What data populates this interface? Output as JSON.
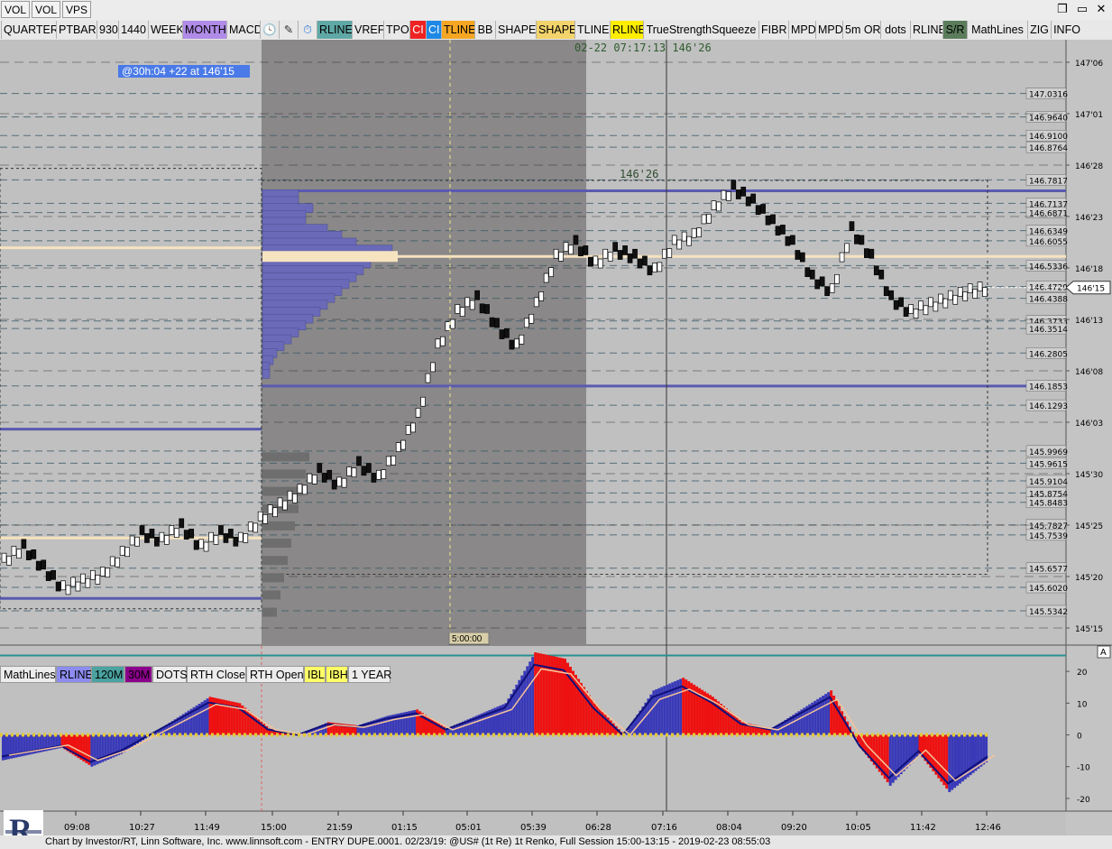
{
  "window": {
    "tabs": [
      "VOL",
      "VOL",
      "VPS"
    ],
    "controls": [
      "restore",
      "minimize",
      "close"
    ]
  },
  "toolbar": {
    "buttons": [
      {
        "label": "QUARTER",
        "bg": "#e8e8e8"
      },
      {
        "label": "PTBAR",
        "bg": "#e8e8e8"
      },
      {
        "label": "930",
        "bg": "#e8e8e8"
      },
      {
        "label": "1440",
        "bg": "#e8e8e8"
      },
      {
        "label": "WEEK",
        "bg": "#e8e8e8"
      },
      {
        "label": "MONTH",
        "bg": "#b08be8"
      },
      {
        "label": "MACD",
        "bg": "#e8e8e8"
      },
      {
        "label": "",
        "icon": "clock-icon",
        "bg": "#e8e8e8"
      },
      {
        "label": "",
        "icon": "pencil-icon",
        "bg": "#e8e8e8"
      },
      {
        "label": "",
        "icon": "stopwatch-icon",
        "bg": "#e8e8e8"
      },
      {
        "label": "RLINE",
        "bg": "#5fa8a6"
      },
      {
        "label": "VREF",
        "bg": "#e8e8e8"
      },
      {
        "label": "TPO",
        "bg": "#e8e8e8"
      },
      {
        "label": "CI",
        "bg": "#ee2222",
        "color": "#ffffff"
      },
      {
        "label": "CI",
        "bg": "#1e88e5",
        "color": "#ffffff"
      },
      {
        "label": "TLINE",
        "bg": "#f5a623"
      },
      {
        "label": "BB",
        "bg": "#e8e8e8"
      },
      {
        "label": "SHAPE",
        "bg": "#e8e8e8"
      },
      {
        "label": "SHAPE",
        "bg": "#f3d36b"
      },
      {
        "label": "TLINE",
        "bg": "#e8e8e8"
      },
      {
        "label": "RLINE",
        "bg": "#ffee00"
      },
      {
        "label": "TrueStrengthSqueeze",
        "bg": "#e8e8e8"
      },
      {
        "label": "FIBR",
        "bg": "#e8e8e8"
      },
      {
        "label": "MPD",
        "bg": "#e8e8e8"
      },
      {
        "label": "MPD",
        "bg": "#e8e8e8"
      },
      {
        "label": "5m OR",
        "bg": "#e8e8e8"
      },
      {
        "label": "dots",
        "bg": "#e8e8e8"
      },
      {
        "label": "RLINE",
        "bg": "#e8e8e8"
      },
      {
        "label": "S/R",
        "bg": "#5b7d5b"
      },
      {
        "label": "MathLines",
        "bg": "#e8e8e8"
      },
      {
        "label": "ZIG",
        "bg": "#e8e8e8"
      },
      {
        "label": "INFO",
        "bg": "#e8e8e8"
      }
    ]
  },
  "bottom_toolbar": {
    "buttons": [
      {
        "label": "MathLines",
        "bg": "#ececec"
      },
      {
        "label": "RLINE",
        "bg": "#8c8cf0"
      },
      {
        "label": "120M",
        "bg": "#4aa3a0"
      },
      {
        "label": "30M",
        "bg": "#8b008b"
      },
      {
        "label": "DOTS",
        "bg": "#ececec"
      },
      {
        "label": "RTH Close",
        "bg": "#ececec"
      },
      {
        "label": "RTH Open",
        "bg": "#ececec"
      },
      {
        "label": "IBL",
        "bg": "#ffff66"
      },
      {
        "label": "IBH",
        "bg": "#ffff66"
      },
      {
        "label": "1 YEAR",
        "bg": "#ececec"
      }
    ]
  },
  "annotations": {
    "top_info": "02-22 07:17:13  146'26",
    "hud_label": "@30h:04  +22 at 146'15",
    "level_label": "146'26",
    "duration": "5:00:00",
    "current_price": "146'15",
    "indicator_marker": "A"
  },
  "footer": {
    "text": "Chart by Investor/RT, Linn Software, Inc. www.linnsoft.com - ENTRY DUPE.0001.     02/23/19: @US# (1t Re)  1t Renko, Full Session 15:00-13:15 - 2019-02-23 08:55:03"
  },
  "chart_data": [
    {
      "type": "line",
      "name": "price-panel",
      "x_ticks": [
        "09:08",
        "10:27",
        "11:49",
        "15:00",
        "21:59",
        "01:15",
        "05:01",
        "05:39",
        "06:28",
        "07:16",
        "08:04",
        "09:20",
        "10:05",
        "11:42",
        "12:46"
      ],
      "y_ticks": [
        "147'06",
        "147'01",
        "146'28",
        "146'23",
        "146'18",
        "146'13",
        "146'08",
        "146'03",
        "145'30",
        "145'25",
        "145'20",
        "145'15"
      ],
      "ylim": [
        145.4375,
        147.1875
      ],
      "price_levels": [
        147.0316,
        146.964,
        146.91,
        146.8764,
        146.7817,
        146.7137,
        146.6871,
        146.6349,
        146.6055,
        146.5336,
        146.4729,
        146.4388,
        146.3733,
        146.3514,
        146.2805,
        146.1853,
        146.1293,
        145.9969,
        145.9615,
        145.9104,
        145.8754,
        145.8483,
        145.7827,
        145.7539,
        145.6577,
        145.602,
        145.5342
      ],
      "price_level_labels": [
        "147.0316",
        "146.9640",
        "146.9100",
        "146.8764",
        "146.7817",
        "146.7137",
        "146.6871",
        "146.6349",
        "146.6055",
        "146.5336",
        "146.4729",
        "146.4388",
        "146.3733",
        "146.3514",
        "146.2805",
        "146.1853",
        "146.1293",
        "145.9969",
        "145.9615",
        "145.9104",
        "145.8754",
        "145.8483",
        "145.7827",
        "145.7539",
        "145.6577",
        "145.6020",
        "145.5342"
      ],
      "path_x": [
        0,
        0.02,
        0.04,
        0.06,
        0.08,
        0.1,
        0.12,
        0.14,
        0.16,
        0.18,
        0.2,
        0.22,
        0.24,
        0.26,
        0.28,
        0.3,
        0.32,
        0.34,
        0.36,
        0.38,
        0.4,
        0.42,
        0.44,
        0.46,
        0.48,
        0.5,
        0.52,
        0.54,
        0.56,
        0.58,
        0.6,
        0.62,
        0.64,
        0.66,
        0.68,
        0.7,
        0.72,
        0.74,
        0.76,
        0.78,
        0.8,
        0.82,
        0.84,
        0.86,
        0.88,
        0.9,
        0.92,
        0.94,
        0.96,
        0.98,
        1.0
      ],
      "path_y": [
        145.68,
        145.72,
        145.66,
        145.6,
        145.62,
        145.64,
        145.7,
        145.76,
        145.74,
        145.78,
        145.72,
        145.76,
        145.74,
        145.8,
        145.84,
        145.88,
        145.94,
        145.9,
        145.96,
        145.92,
        146.0,
        146.1,
        146.3,
        146.4,
        146.44,
        146.36,
        146.3,
        146.42,
        146.56,
        146.6,
        146.54,
        146.58,
        146.56,
        146.52,
        146.6,
        146.62,
        146.7,
        146.76,
        146.72,
        146.66,
        146.6,
        146.5,
        146.46,
        146.64,
        146.56,
        146.44,
        146.4,
        146.42,
        146.44,
        146.46,
        146.47
      ],
      "profile_bins": [
        146.74,
        146.72,
        146.7,
        146.68,
        146.66,
        146.64,
        146.62,
        146.6,
        146.58,
        146.56,
        146.54,
        146.52,
        146.5,
        146.48,
        146.46,
        146.44,
        146.42,
        146.4,
        146.38,
        146.36,
        146.34,
        146.32,
        146.3,
        146.28,
        146.26,
        146.24,
        146.22
      ],
      "profile_volume": [
        10,
        10,
        14,
        12,
        12,
        18,
        22,
        26,
        36,
        34,
        30,
        28,
        26,
        24,
        22,
        20,
        18,
        16,
        14,
        12,
        10,
        8,
        6,
        4,
        3,
        2,
        2
      ],
      "profile_poc": 146.56
    },
    {
      "type": "bar",
      "name": "indicator-panel",
      "y_ticks": [
        "20",
        "10",
        "0",
        "-10",
        "-20"
      ],
      "ylim": [
        -24,
        28
      ],
      "zero_line": 0,
      "upper_level": 25,
      "path_x": [
        0,
        0.03,
        0.06,
        0.09,
        0.12,
        0.15,
        0.18,
        0.21,
        0.24,
        0.27,
        0.3,
        0.33,
        0.36,
        0.39,
        0.42,
        0.45,
        0.48,
        0.51,
        0.54,
        0.57,
        0.6,
        0.63,
        0.66,
        0.69,
        0.72,
        0.75,
        0.78,
        0.81,
        0.84,
        0.87,
        0.9,
        0.93,
        0.96,
        1.0
      ],
      "values": [
        -8,
        -6,
        -4,
        -10,
        -6,
        0,
        6,
        12,
        10,
        2,
        0,
        4,
        3,
        6,
        8,
        2,
        6,
        10,
        26,
        24,
        10,
        0,
        14,
        18,
        12,
        4,
        2,
        8,
        14,
        -4,
        -16,
        -6,
        -18,
        -8
      ]
    }
  ]
}
